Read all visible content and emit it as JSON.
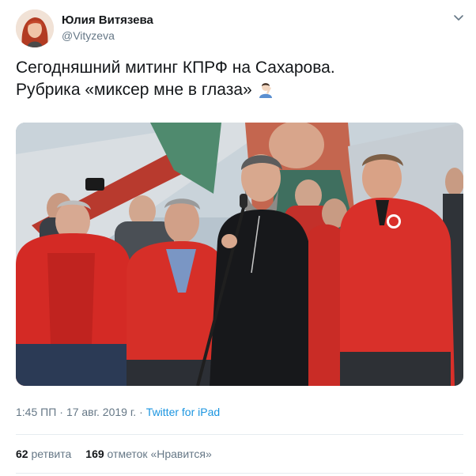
{
  "author": {
    "name": "Юлия Витязева",
    "handle": "@Vityzeva"
  },
  "tweet": {
    "line1": "Сегодняшний митинг КПРФ на Сахарова.",
    "line2": "Рубрика «миксер мне в глаза»",
    "emoji": "facepalm-icon"
  },
  "meta": {
    "time": "1:45 ПП",
    "separator": "·",
    "date": "17 авг. 2019 г.",
    "separator2": "·",
    "source": "Twitter for iPad"
  },
  "stats": {
    "retweets_count": "62",
    "retweets_label": "ретвита",
    "likes_count": "169",
    "likes_label": "отметок «Нравится»"
  },
  "colors": {
    "link": "#1b95e0",
    "secondary_text": "#657786",
    "primary_text": "#14171a",
    "jacket_red": "#d42a25"
  }
}
